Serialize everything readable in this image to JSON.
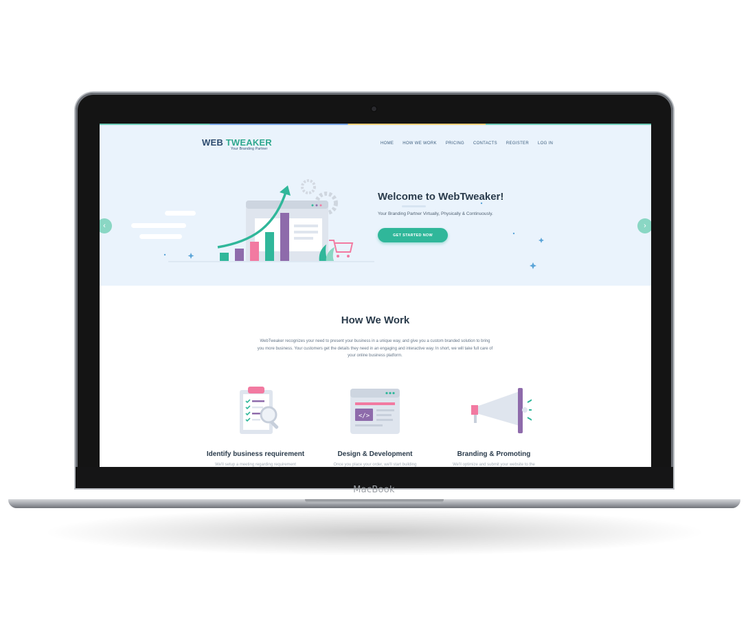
{
  "device": {
    "label": "MacBook"
  },
  "site": {
    "logo": {
      "word1": "WEB",
      "word2": "TWEAKER",
      "tagline": "Your Branding Partner"
    },
    "nav": {
      "items": [
        "HOME",
        "HOW WE WORK",
        "PRICING",
        "CONTACTS",
        "REGISTER",
        "LOG IN"
      ]
    },
    "hero": {
      "title": "Welcome to WebTweaker!",
      "subtitle": "Your Branding Partner Virtually, Physically & Continuously.",
      "cta": "GET STARTED NOW",
      "prev_icon": "chevron-left-icon",
      "next_icon": "chevron-right-icon"
    },
    "how_we_work": {
      "title": "How We Work",
      "text": "WebTweaker recognizes your need to present your business in a unique way, and give you a custom branded solution to bring you more business. Your customers get the details they need in an engaging and interactive way. In short, we will take full care of your online business platform.",
      "features": [
        {
          "title": "Identify business requirement",
          "desc": "We'll setup a meeting regarding requirement",
          "icon": "clipboard-checklist-icon"
        },
        {
          "title": "Design & Development",
          "desc": "Once you place your order, we'll start building",
          "icon": "code-window-icon"
        },
        {
          "title": "Branding & Promoting",
          "desc": "We'll optimize and submit your website to the",
          "icon": "megaphone-icon"
        }
      ]
    }
  },
  "colors": {
    "accent": "#30b79a",
    "heading": "#2a3b4b",
    "hero_bg": "#eaf3fc",
    "pink": "#f27aa1",
    "purple": "#8e6bab",
    "navy": "#2d4b6e"
  }
}
